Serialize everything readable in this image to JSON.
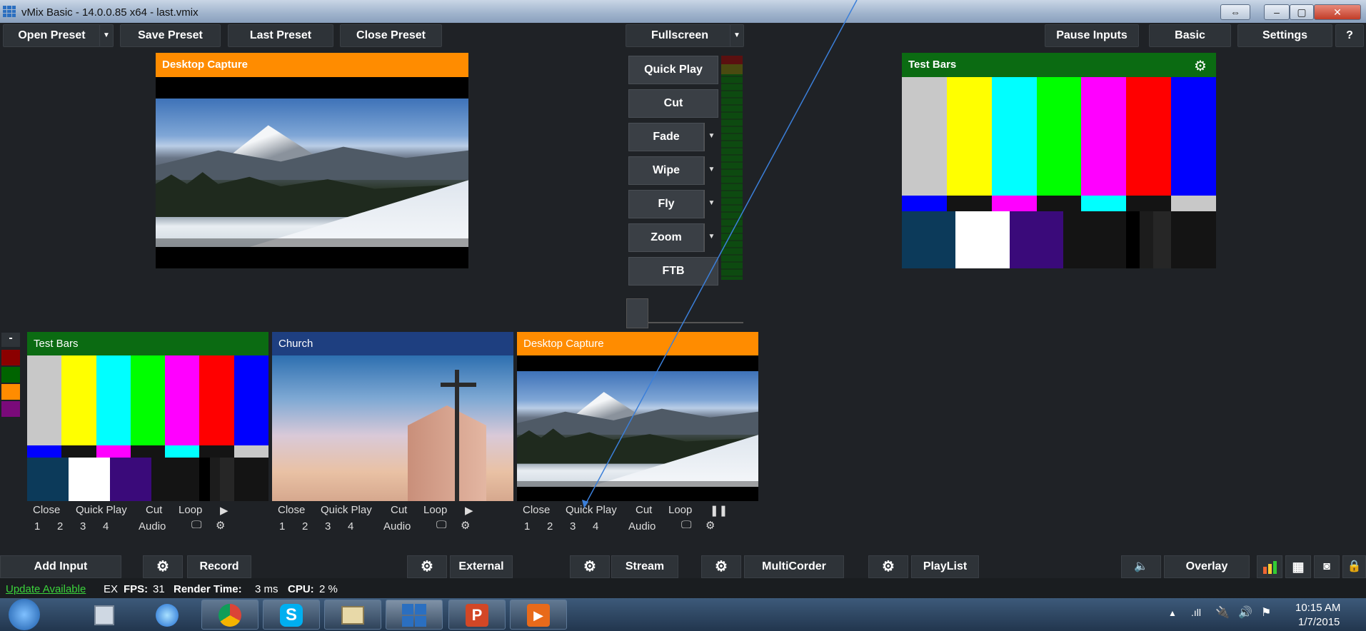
{
  "window": {
    "title": "vMix Basic - 14.0.0.85 x64 - last.vmix"
  },
  "toolbar": {
    "open_preset": "Open Preset",
    "save_preset": "Save Preset",
    "last_preset": "Last Preset",
    "close_preset": "Close Preset",
    "fullscreen": "Fullscreen",
    "pause_inputs": "Pause Inputs",
    "basic": "Basic",
    "settings": "Settings",
    "help": "?"
  },
  "preview": {
    "title": "Desktop Capture"
  },
  "output": {
    "title": "Test Bars"
  },
  "transitions": {
    "quick_play": "Quick Play",
    "cut": "Cut",
    "fade": "Fade",
    "wipe": "Wipe",
    "fly": "Fly",
    "zoom": "Zoom",
    "ftb": "FTB"
  },
  "inputs": [
    {
      "title": "Test Bars",
      "close": "Close",
      "quick_play": "Quick Play",
      "cut": "Cut",
      "loop": "Loop",
      "n1": "1",
      "n2": "2",
      "n3": "3",
      "n4": "4",
      "audio": "Audio"
    },
    {
      "title": "Church",
      "close": "Close",
      "quick_play": "Quick Play",
      "cut": "Cut",
      "loop": "Loop",
      "n1": "1",
      "n2": "2",
      "n3": "3",
      "n4": "4",
      "audio": "Audio"
    },
    {
      "title": "Desktop Capture",
      "close": "Close",
      "quick_play": "Quick Play",
      "cut": "Cut",
      "loop": "Loop",
      "n1": "1",
      "n2": "2",
      "n3": "3",
      "n4": "4",
      "audio": "Audio"
    }
  ],
  "bottombar": {
    "add_input": "Add Input",
    "record": "Record",
    "external": "External",
    "stream": "Stream",
    "multicorder": "MultiCorder",
    "playlist": "PlayList",
    "overlay": "Overlay"
  },
  "status": {
    "update": "Update Available",
    "ex": "EX",
    "fps_label": "FPS:",
    "fps_value": "31",
    "render_label": "Render Time:",
    "render_value": "3 ms",
    "cpu_label": "CPU:",
    "cpu_value": "2 %"
  },
  "taskbar": {
    "time": "10:15 AM",
    "date": "1/7/2015"
  },
  "colors": {
    "accent_orange": "#ff8c00",
    "accent_green": "#0b6b12",
    "accent_blue": "#1e3f80"
  }
}
